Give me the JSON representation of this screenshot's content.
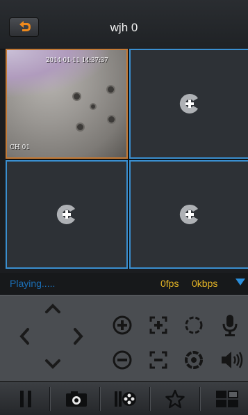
{
  "header": {
    "title": "wjh 0",
    "back_icon": "back-arrow-icon",
    "back_color": "#f08a1c"
  },
  "grid": {
    "active_cell": {
      "timestamp": "2014-01-11 14:37:37",
      "channel": "CH 01"
    },
    "empty_cells_icon": "add-camera-icon"
  },
  "status": {
    "state": "Playing.....",
    "fps": "0fps",
    "kbps": "0kbps"
  },
  "ptz": {
    "direction_icons": [
      "arrow-up-icon",
      "arrow-left-icon",
      "arrow-right-icon",
      "arrow-down-icon"
    ],
    "zoom_in": "zoom-in-icon",
    "zoom_out": "zoom-out-icon",
    "focus_in": "focus-near-icon",
    "focus_out": "focus-far-icon",
    "iris_open": "iris-open-icon",
    "iris_close": "iris-close-icon",
    "mic": "microphone-icon",
    "speaker": "speaker-icon"
  },
  "toolbar": [
    "pause-icon",
    "snapshot-icon",
    "record-icon",
    "favorite-icon",
    "layout-icon"
  ],
  "colors": {
    "accent": "#3a8fd0",
    "active_border": "#c47a35",
    "status_text": "#1b6fb6",
    "rate_text": "#e6b625"
  }
}
